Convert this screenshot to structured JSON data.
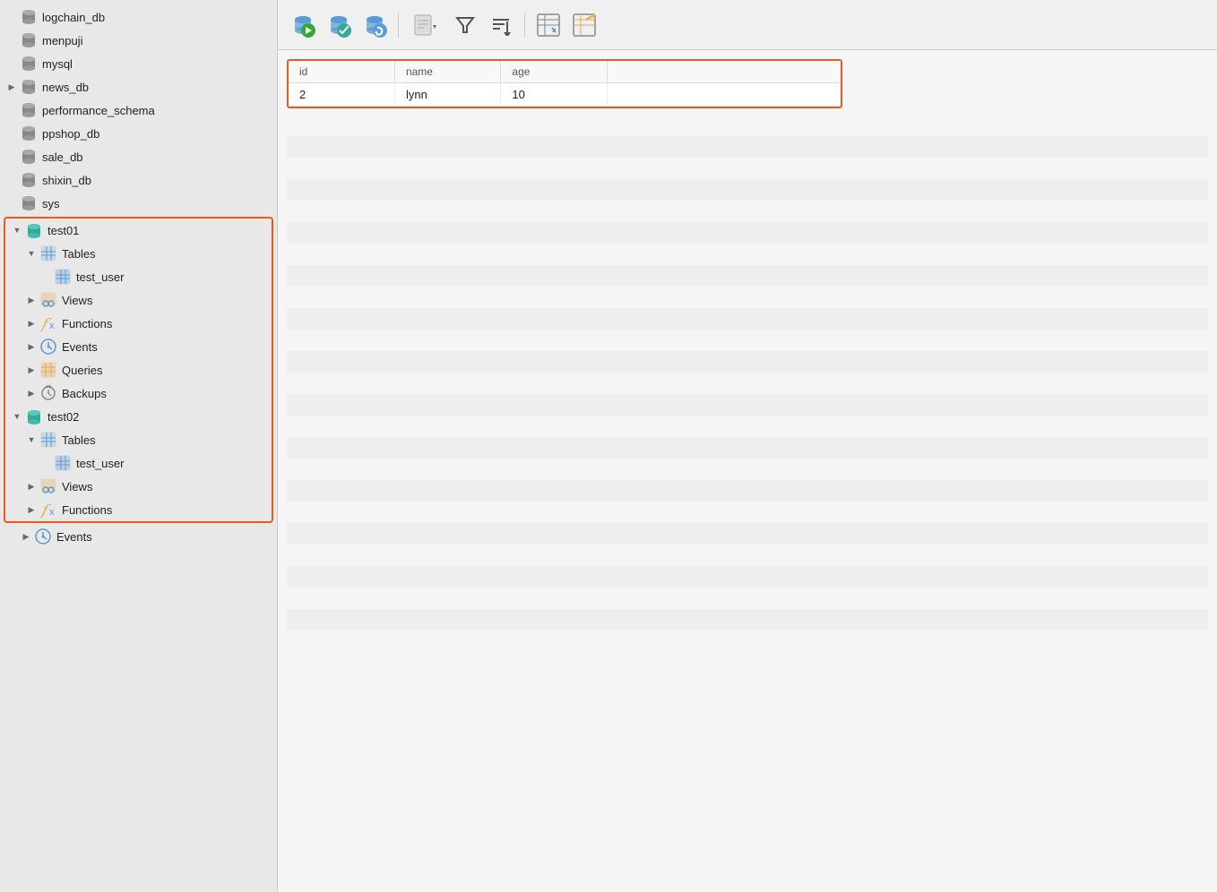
{
  "sidebar": {
    "databases": [
      {
        "name": "logchain_db",
        "type": "gray",
        "indent": 0,
        "expanded": false
      },
      {
        "name": "menpuji",
        "type": "gray",
        "indent": 0,
        "expanded": false
      },
      {
        "name": "mysql",
        "type": "gray",
        "indent": 0,
        "expanded": false
      },
      {
        "name": "news_db",
        "type": "gray",
        "indent": 0,
        "expanded": false,
        "hasArrow": true
      },
      {
        "name": "performance_schema",
        "type": "gray",
        "indent": 0,
        "expanded": false
      },
      {
        "name": "ppshop_db",
        "type": "gray",
        "indent": 0,
        "expanded": false
      },
      {
        "name": "sale_db",
        "type": "gray",
        "indent": 0,
        "expanded": false
      },
      {
        "name": "shixin_db",
        "type": "gray",
        "indent": 0,
        "expanded": false
      },
      {
        "name": "sys",
        "type": "gray",
        "indent": 0,
        "expanded": false
      }
    ],
    "selected_group": {
      "test01": {
        "name": "test01",
        "children": [
          {
            "label": "Tables",
            "icon": "table",
            "indent": 1,
            "expanded": true
          },
          {
            "label": "test_user",
            "icon": "table",
            "indent": 2
          },
          {
            "label": "Views",
            "icon": "views",
            "indent": 1,
            "expanded": false
          },
          {
            "label": "Functions",
            "icon": "fx",
            "indent": 1,
            "expanded": false
          },
          {
            "label": "Events",
            "icon": "events",
            "indent": 1,
            "expanded": false
          },
          {
            "label": "Queries",
            "icon": "queries",
            "indent": 1,
            "expanded": false
          },
          {
            "label": "Backups",
            "icon": "backups",
            "indent": 1,
            "expanded": false
          }
        ]
      },
      "test02": {
        "name": "test02",
        "children": [
          {
            "label": "Tables",
            "icon": "table",
            "indent": 1,
            "expanded": true
          },
          {
            "label": "test_user",
            "icon": "table",
            "indent": 2
          },
          {
            "label": "Views",
            "icon": "views",
            "indent": 1,
            "expanded": false
          },
          {
            "label": "Functions",
            "icon": "fx",
            "indent": 1,
            "expanded": false
          }
        ]
      }
    },
    "below_selected": [
      {
        "label": "Events",
        "icon": "events",
        "indent": 1,
        "expanded": false
      }
    ]
  },
  "toolbar": {
    "buttons": [
      {
        "id": "run",
        "label": "▶",
        "title": "Run"
      },
      {
        "id": "commit",
        "label": "✓",
        "title": "Commit"
      },
      {
        "id": "refresh",
        "label": "↻",
        "title": "Refresh"
      },
      {
        "id": "query",
        "label": "📄",
        "title": "Query"
      },
      {
        "id": "filter",
        "label": "⚗",
        "title": "Filter"
      },
      {
        "id": "sort",
        "label": "↧",
        "title": "Sort"
      },
      {
        "id": "export",
        "label": "⊡",
        "title": "Export"
      },
      {
        "id": "import",
        "label": "⊞",
        "title": "Import"
      }
    ]
  },
  "result": {
    "columns": [
      "id",
      "name",
      "age",
      ""
    ],
    "rows": [
      {
        "id": "2",
        "name": "lynn",
        "age": "10",
        "extra": ""
      }
    ]
  }
}
